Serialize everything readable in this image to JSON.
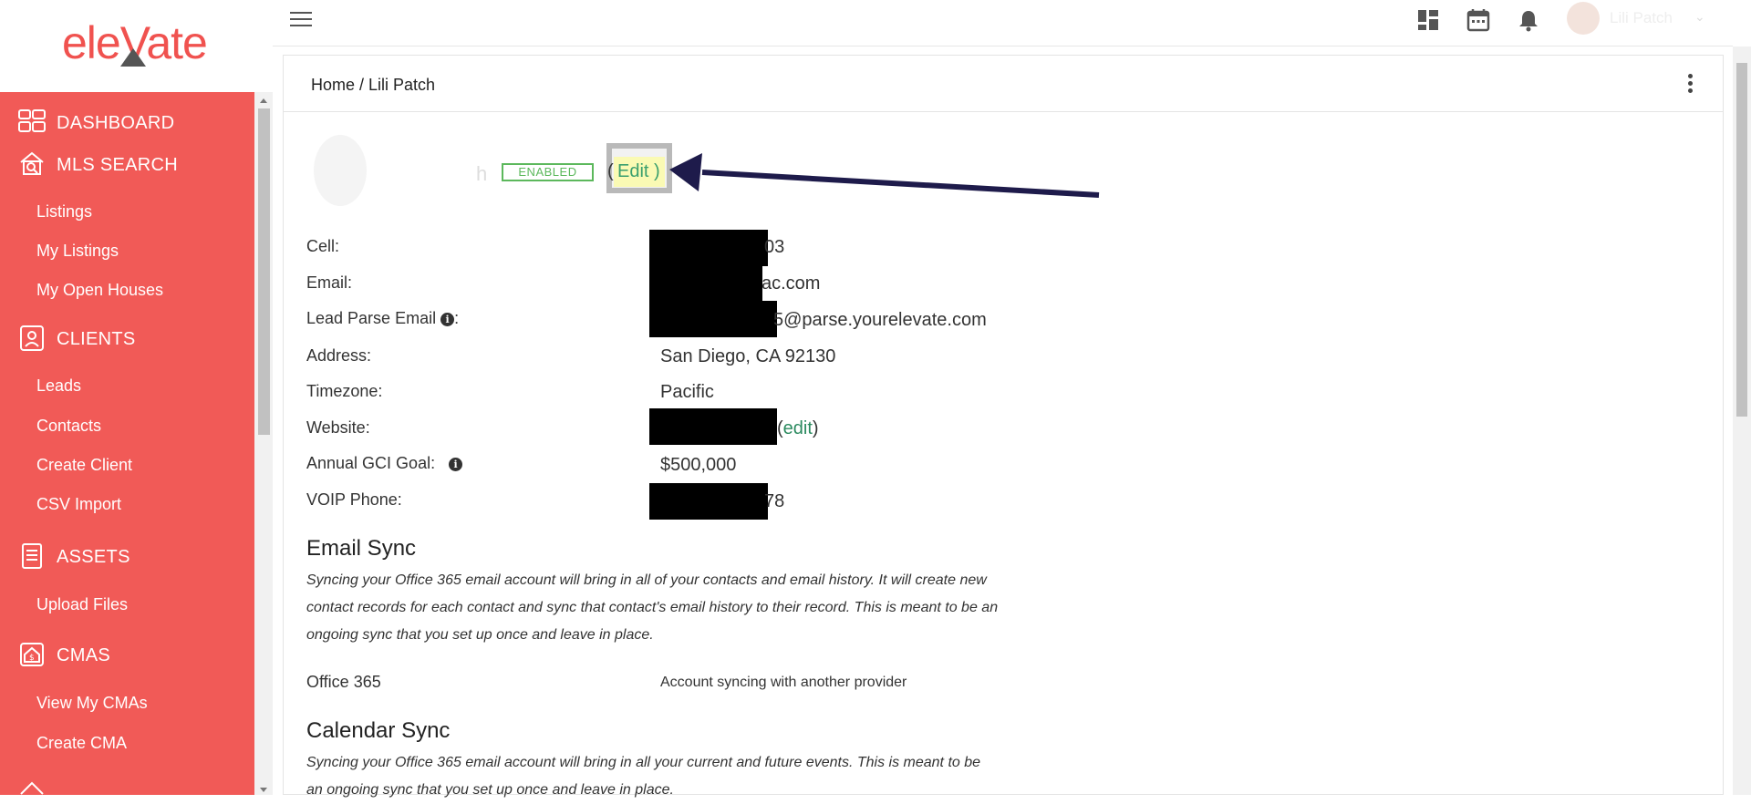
{
  "app": {
    "logo_text": "eleVate",
    "brand_color": "#f15a57",
    "accent_color": "#2b8a5f"
  },
  "sidebar": {
    "sections": [
      {
        "label": "DASHBOARD",
        "icon": "dashboard-icon"
      },
      {
        "label": "MLS SEARCH",
        "icon": "house-search-icon"
      },
      {
        "label": "CLIENTS",
        "icon": "contact-card-icon"
      },
      {
        "label": "ASSETS",
        "icon": "document-icon"
      },
      {
        "label": "CMAS",
        "icon": "house-dollar-icon"
      }
    ],
    "items": [
      "Listings",
      "My Listings",
      "My Open Houses",
      "Leads",
      "Contacts",
      "Create Client",
      "CSV Import",
      "Upload Files",
      "View My CMAs",
      "Create CMA"
    ]
  },
  "topbar": {
    "icons": [
      "menu-icon",
      "layout-icon",
      "calendar-icon",
      "bell-icon",
      "user-avatar-icon",
      "chevron-down-icon"
    ],
    "user_name": "Lili Patch"
  },
  "breadcrumb": "Home / Lili Patch",
  "profile": {
    "name_partial": "h",
    "status_badge": "ENABLED",
    "edit_open": "(",
    "edit_label": "Edit )"
  },
  "details": {
    "cell_label": "Cell:",
    "cell_value": "03",
    "email_label": "Email:",
    "email_value": "ac.com",
    "lead_parse_label": "Lead Parse Email",
    "lead_parse_colon": ":",
    "lead_parse_value": "5@parse.yourelevate.com",
    "address_label": "Address:",
    "address_value": "San Diego, CA 92130",
    "timezone_label": "Timezone:",
    "timezone_value": "Pacific",
    "website_label": "Website:",
    "website_open": "(",
    "website_edit": "edit",
    "website_close": ")",
    "gci_label": "Annual GCI Goal:",
    "gci_value": "$500,000",
    "voip_label": "VOIP Phone:",
    "voip_value": "78"
  },
  "email_sync": {
    "title": "Email Sync",
    "description": "Syncing your Office 365 email account will bring in all of your contacts and email history. It will create new contact records for each contact and sync that contact's email history to their record. This is meant to be an ongoing sync that you set up once and leave in place.",
    "provider": "Office 365",
    "provider_status": "Account syncing with another provider"
  },
  "calendar_sync": {
    "title": "Calendar Sync",
    "description": "Syncing your Office 365 email account will bring in all your current and future events. This is meant to be an ongoing sync that you set up once and leave in place."
  }
}
